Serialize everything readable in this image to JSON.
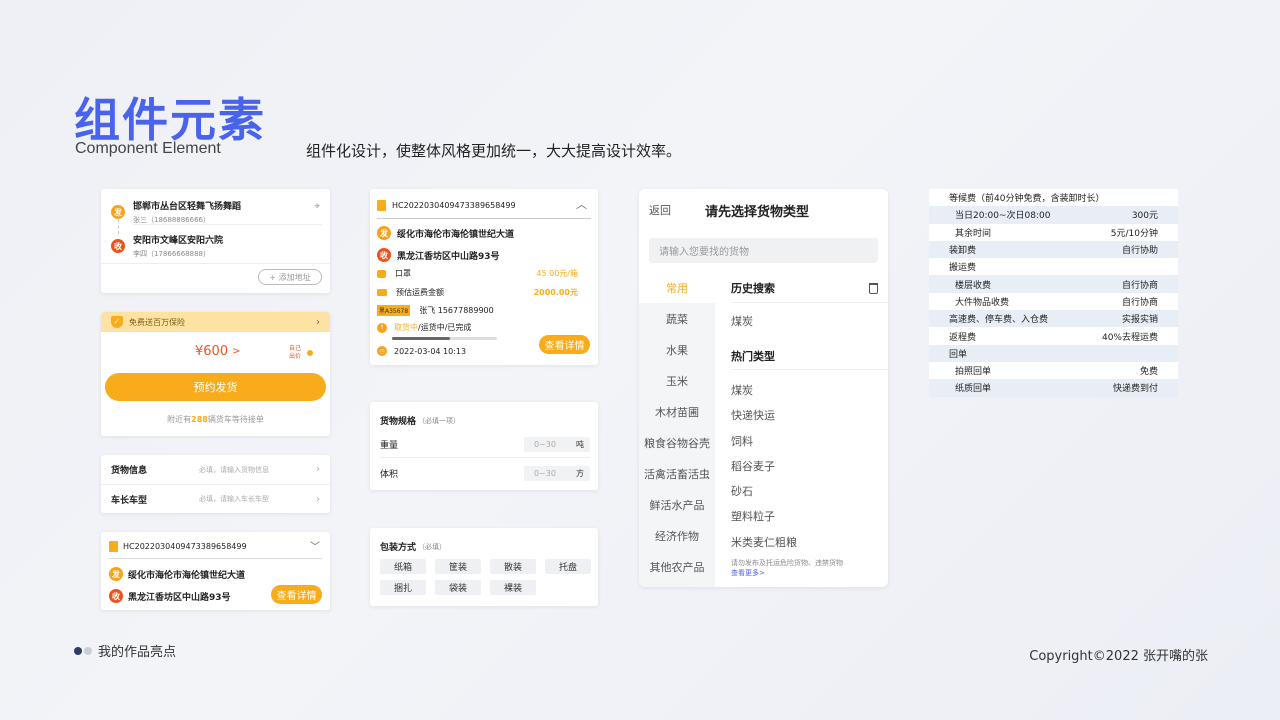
{
  "header": {
    "title": "组件元素",
    "title_en": "Component Element",
    "subtitle": "组件化设计，使整体风格更加统一，大大提高设计效率。"
  },
  "footer": {
    "left_label": "我的作品亮点",
    "copyright": "Copyright©2022 张开嘴的张"
  },
  "address_card": {
    "from_badge": "发",
    "from_address": "邯郸市丛台区轻舞飞扬舞蹈",
    "from_contact": "张三（18688886666）",
    "to_badge": "收",
    "to_address": "安阳市文峰区安阳六院",
    "to_contact": "李四（17866668888）",
    "add_button": "+ 添加地址"
  },
  "order_card": {
    "insurance_label": "免费送百万保险",
    "price": "¥600",
    "price_arrow": ">",
    "self_price": "自己出价",
    "book_button": "预约发货",
    "nearby_prefix": "附近有",
    "nearby_count": "288",
    "nearby_suffix": "辆货车等待接单"
  },
  "info_card": {
    "rows": [
      {
        "label": "货物信息",
        "placeholder": "必填，请输入货物信息"
      },
      {
        "label": "车长车型",
        "placeholder": "必填，请输入车长车型"
      }
    ]
  },
  "waybill_small": {
    "number": "HC2022030409473389658499",
    "from_badge": "发",
    "from_address": "绥化市海伦市海伦镇世纪大道",
    "to_badge": "收",
    "to_address": "黑龙江香坊区中山路93号",
    "detail_button": "查看详情"
  },
  "waybill_large": {
    "number": "HC2022030409473389658499",
    "from_badge": "发",
    "from_address": "绥化市海伦市海伦镇世纪大道",
    "to_badge": "收",
    "to_address": "黑龙江香坊区中山路93号",
    "item_name": "口罩",
    "item_price": "45.00元/箱",
    "fee_label": "预估运费金额",
    "fee_value": "2000.00元",
    "plate": "黑A35678",
    "driver": "张飞 15677889900",
    "status_active": "取货中",
    "status_rest": "/运货中/已完成",
    "progress": 0.55,
    "date": "2022-03-04  10:13",
    "detail_button": "查看详情"
  },
  "spec_card": {
    "title": "货物规格",
    "hint": "（必填一项）",
    "rows": [
      {
        "label": "重量",
        "placeholder": "0~30",
        "unit": "吨"
      },
      {
        "label": "体积",
        "placeholder": "0~30",
        "unit": "方"
      }
    ]
  },
  "package_card": {
    "title": "包装方式",
    "hint": "（必填）",
    "tags": [
      "纸箱",
      "筐装",
      "散装",
      "托盘",
      "捆扎",
      "袋装",
      "裸装"
    ]
  },
  "cargo_picker": {
    "back": "返回",
    "title": "请先选择货物类型",
    "search_placeholder": "请输入您要找的货物",
    "side_items": [
      "常用",
      "蔬菜",
      "水果",
      "玉米",
      "木材苗圃",
      "粮食谷物谷壳",
      "活禽活畜活虫",
      "鲜活水产品",
      "经济作物",
      "其他农产品"
    ],
    "active_index": 0,
    "history_title": "历史搜索",
    "history_items": [
      "煤炭"
    ],
    "hot_title": "热门类型",
    "hot_items": [
      "煤炭",
      "快递快运",
      "饲料",
      "稻谷麦子",
      "砂石",
      "塑料粒子",
      "米类麦仁粗粮"
    ],
    "notice": "请勿发布及托运危险货物、违禁货物",
    "more_link": "查看更多>"
  },
  "fee_table": {
    "rows": [
      {
        "label": "等候费（前40分钟免费，含装卸时长）",
        "value": "",
        "style": "head"
      },
      {
        "label": "当日20:00~次日08:00",
        "value": "300元",
        "style": "blue-sub"
      },
      {
        "label": "其余时间",
        "value": "5元/10分钟",
        "style": "sub"
      },
      {
        "label": "装卸费",
        "value": "自行协助",
        "style": "blue"
      },
      {
        "label": "搬运费",
        "value": "",
        "style": "plain"
      },
      {
        "label": "楼层收费",
        "value": "自行协商",
        "style": "blue-sub"
      },
      {
        "label": "大件物品收费",
        "value": "自行协商",
        "style": "sub"
      },
      {
        "label": "高速费、停车费、入仓费",
        "value": "实报实销",
        "style": "blue"
      },
      {
        "label": "返程费",
        "value": "40%去程运费",
        "style": "plain"
      },
      {
        "label": "回单",
        "value": "",
        "style": "blue"
      },
      {
        "label": "拍照回单",
        "value": "免费",
        "style": "sub"
      },
      {
        "label": "纸质回单",
        "value": "快递费到付",
        "style": "blue-sub"
      }
    ]
  },
  "colors": {
    "brand_blue": "#4a63ec",
    "accent_orange": "#f9ac1b",
    "badge_red": "#f0521c",
    "table_blue": "#e8eef6"
  }
}
